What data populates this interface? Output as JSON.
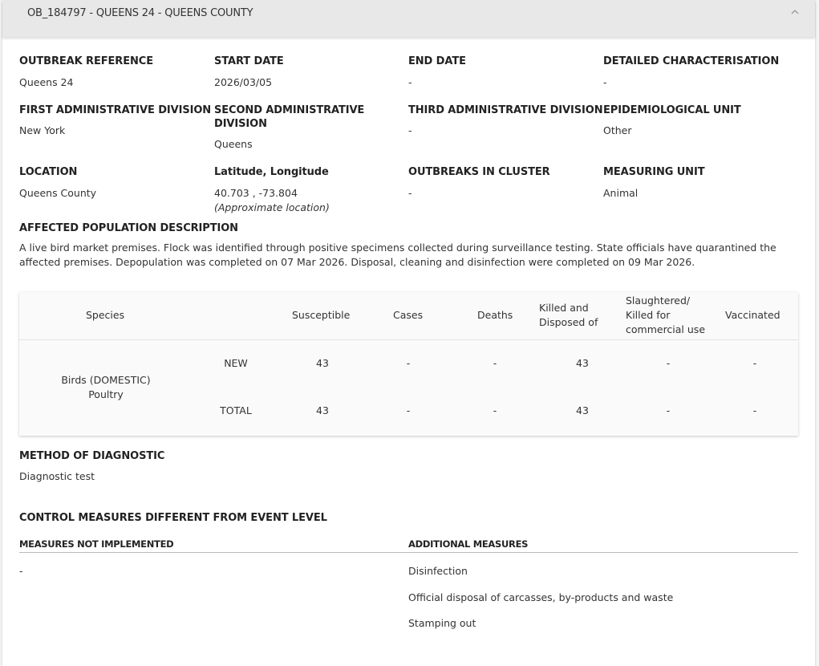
{
  "header": {
    "title": "OB_184797 - QUEENS 24 - QUEENS COUNTY"
  },
  "fields": {
    "outbreak_reference": {
      "label": "OUTBREAK REFERENCE",
      "value": "Queens 24"
    },
    "start_date": {
      "label": "START DATE",
      "value": "2026/03/05"
    },
    "end_date": {
      "label": "END DATE",
      "value": "-"
    },
    "detailed_characterisation": {
      "label": "DETAILED CHARACTERISATION",
      "value": "-"
    },
    "first_admin_division": {
      "label": "FIRST ADMINISTRATIVE DIVISION",
      "value": "New York"
    },
    "second_admin_division": {
      "label_line1": "SECOND ADMINISTRATIVE",
      "label_line2": "DIVISION",
      "value": "Queens"
    },
    "third_admin_division": {
      "label": "THIRD ADMINISTRATIVE DIVISION",
      "value": "-"
    },
    "epidemiological_unit": {
      "label": "EPIDEMIOLOGICAL UNIT",
      "value": "Other"
    },
    "location": {
      "label": "LOCATION",
      "value": "Queens County"
    },
    "lat_long": {
      "label": "Latitude, Longitude",
      "value": "40.703 , -73.804",
      "note": "(Approximate location)"
    },
    "outbreaks_in_cluster": {
      "label": "OUTBREAKS IN CLUSTER",
      "value": "-"
    },
    "measuring_unit": {
      "label": "MEASURING UNIT",
      "value": "Animal"
    }
  },
  "affected_population": {
    "label": "AFFECTED POPULATION DESCRIPTION",
    "text": "A live bird market premises. Flock was identified through positive specimens collected during surveillance testing. State officials have quarantined the affected premises. Depopulation was completed on 07 Mar 2026. Disposal, cleaning and disinfection were completed on 09 Mar 2026."
  },
  "table": {
    "headers": {
      "species": "Species",
      "susceptible": "Susceptible",
      "cases": "Cases",
      "deaths": "Deaths",
      "killed_line1": "Killed and",
      "killed_line2": "Disposed of",
      "slaughtered_line1": "Slaughtered/",
      "slaughtered_line2": "Killed for",
      "slaughtered_line3": "commercial use",
      "vaccinated": "Vaccinated"
    },
    "species_line1": "Birds (DOMESTIC)",
    "species_line2": "Poultry",
    "rows": [
      {
        "type": "NEW",
        "susceptible": "43",
        "cases": "-",
        "deaths": "-",
        "killed": "43",
        "slaughtered": "-",
        "vaccinated": "-"
      },
      {
        "type": "TOTAL",
        "susceptible": "43",
        "cases": "-",
        "deaths": "-",
        "killed": "43",
        "slaughtered": "-",
        "vaccinated": "-"
      }
    ]
  },
  "diagnostic": {
    "label": "METHOD OF DIAGNOSTIC",
    "value": "Diagnostic test"
  },
  "control_measures": {
    "label": "CONTROL MEASURES DIFFERENT FROM EVENT LEVEL",
    "not_implemented_label": "MEASURES NOT IMPLEMENTED",
    "not_implemented": [
      "-"
    ],
    "additional_label": "ADDITIONAL MEASURES",
    "additional": [
      "Disinfection",
      "Official disposal of carcasses, by-products and waste",
      "Stamping out"
    ]
  }
}
